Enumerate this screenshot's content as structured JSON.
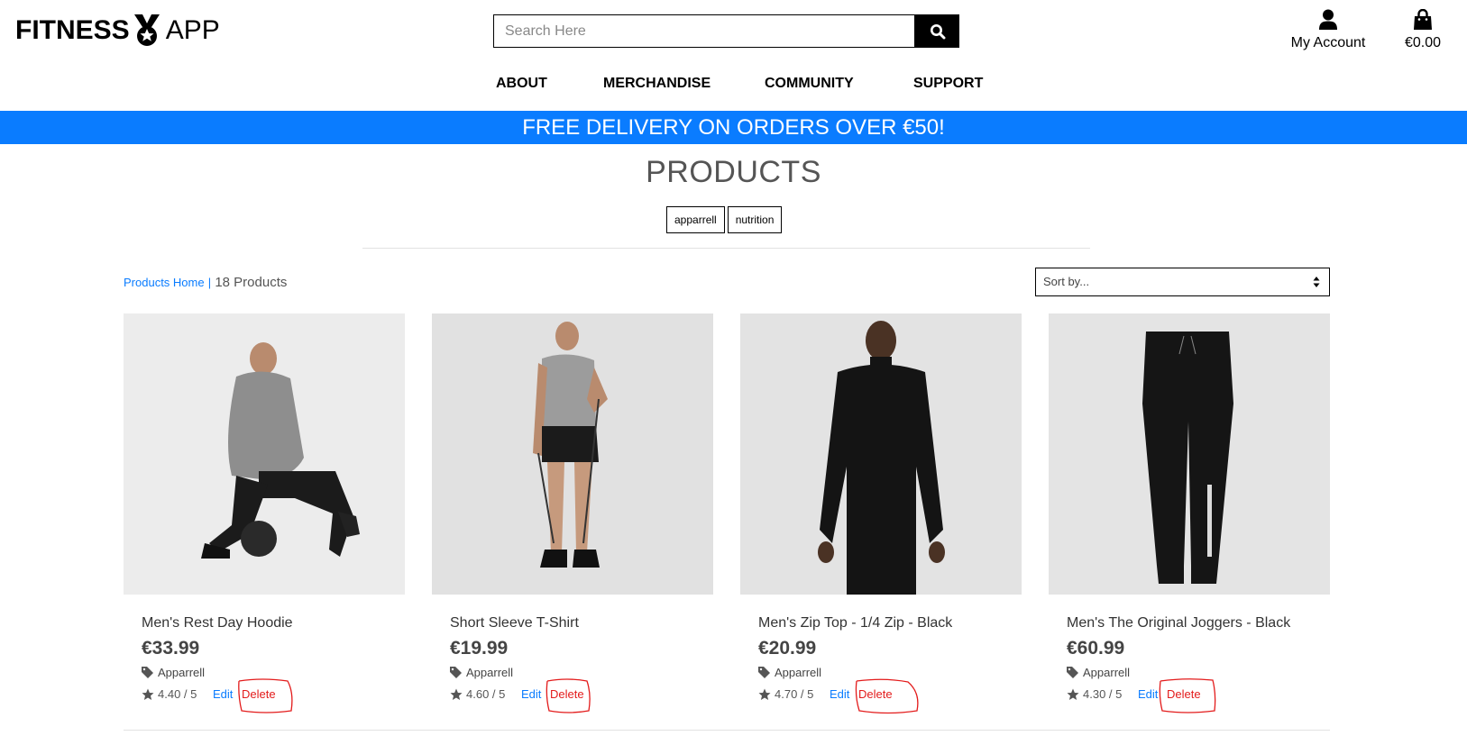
{
  "header": {
    "logo": {
      "word1": "FITNESS",
      "word2": "APP"
    },
    "search": {
      "placeholder": "Search Here"
    },
    "account_label": "My Account",
    "cart_total": "€0.00"
  },
  "nav": {
    "items": [
      "ABOUT",
      "MERCHANDISE",
      "COMMUNITY",
      "SUPPORT"
    ]
  },
  "banner": {
    "text": "FREE DELIVERY ON ORDERS OVER €50!",
    "color": "#0a7cff"
  },
  "page": {
    "title": "PRODUCTS",
    "tags": [
      "apparrell",
      "nutrition"
    ],
    "breadcrumb_link": "Products Home",
    "breadcrumb_sep": "|",
    "product_count": "18 Products",
    "sort_label": "Sort by..."
  },
  "products": [
    {
      "name": "Men's Rest Day Hoodie",
      "price": "€33.99",
      "category": "Apparrell",
      "rating": "4.40 / 5",
      "edit": "Edit",
      "delete": "Delete"
    },
    {
      "name": "Short Sleeve T-Shirt",
      "price": "€19.99",
      "category": "Apparrell",
      "rating": "4.60 / 5",
      "edit": "Edit",
      "delete": "Delete"
    },
    {
      "name": "Men's Zip Top - 1/4 Zip - Black",
      "price": "€20.99",
      "category": "Apparrell",
      "rating": "4.70 / 5",
      "edit": "Edit",
      "delete": "Delete"
    },
    {
      "name": "Men's The Original Joggers - Black",
      "price": "€60.99",
      "category": "Apparrell",
      "rating": "4.30 / 5",
      "edit": "Edit",
      "delete": "Delete"
    }
  ],
  "icons": {
    "logo_medal": "medal-icon",
    "search": "search-icon",
    "account": "user-icon",
    "cart": "shopping-bag-icon",
    "category": "tag-icon",
    "rating": "star-icon"
  },
  "colors": {
    "accent": "#0a7cff",
    "delete": "#e31b1b",
    "annotation": "#e31b1b"
  }
}
